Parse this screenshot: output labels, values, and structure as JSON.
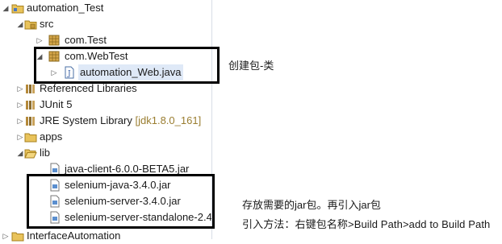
{
  "tree": {
    "project": "automation_Test",
    "src": "src",
    "pkg_test": "com.Test",
    "pkg_webtest": "com.WebTest",
    "java_file": "automation_Web.java",
    "referenced_libraries": "Referenced Libraries",
    "junit": "JUnit 5",
    "jre_library": "JRE System Library",
    "jre_version": "[jdk1.8.0_161]",
    "apps": "apps",
    "lib": "lib",
    "jars": [
      "java-client-6.0.0-BETA5.jar",
      "selenium-java-3.4.0.jar",
      "selenium-server-3.4.0.jar",
      "selenium-server-standalone-2.4"
    ],
    "next_project": "InterfaceAutomation"
  },
  "annotations": {
    "create_package": "创建包-类",
    "store_jars": "存放需要的jar包。再引入jar包",
    "import_method": "引入方法：右键包名称>Build Path>add to Build Path"
  }
}
